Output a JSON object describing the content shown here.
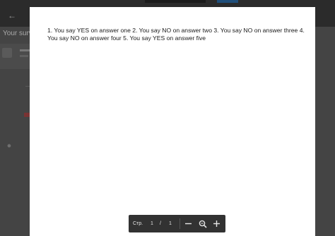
{
  "document": {
    "text": "1. You say YES on answer one 2. You say NO on answer two 3. You say NO on answer three 4. You say NO on answer four 5. You say YES on answer five"
  },
  "background": {
    "title": "Your surv"
  },
  "toolbar": {
    "page_label": "Стр.",
    "current_page": "1",
    "separator": "/",
    "total_pages": "1",
    "zoom_out_icon": "minus-icon",
    "fit_icon": "magnifier-icon",
    "zoom_in_icon": "plus-icon"
  },
  "colors": {
    "toolbar_bg": "#323232",
    "overlay": "#444444"
  }
}
